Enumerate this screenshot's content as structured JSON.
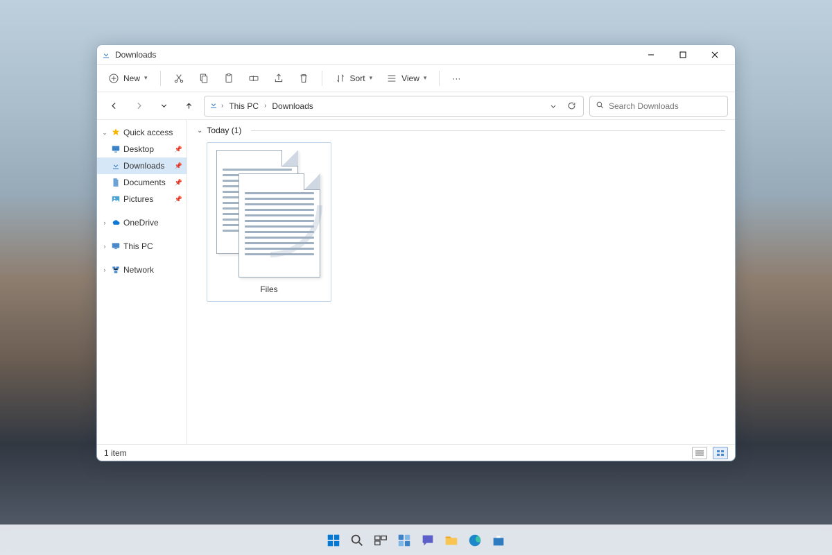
{
  "window": {
    "title": "Downloads"
  },
  "toolbar": {
    "new": "New",
    "sort": "Sort",
    "view": "View",
    "more": "···"
  },
  "breadcrumb": {
    "root": "This PC",
    "current": "Downloads"
  },
  "search": {
    "placeholder": "Search Downloads"
  },
  "sidebar": {
    "quickaccess": "Quick access",
    "desktop": "Desktop",
    "downloads": "Downloads",
    "documents": "Documents",
    "pictures": "Pictures",
    "onedrive": "OneDrive",
    "thispc": "This PC",
    "network": "Network"
  },
  "group": {
    "label": "Today (1)"
  },
  "items": [
    {
      "name": "Files"
    }
  ],
  "status": {
    "count": "1 item"
  }
}
